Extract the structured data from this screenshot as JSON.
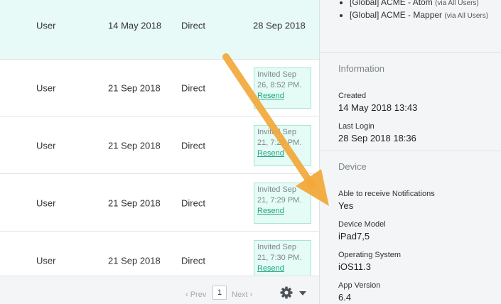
{
  "table": {
    "rows": [
      {
        "role": "User",
        "created": "14 May 2018",
        "type": "Direct",
        "last_login": "28 Sep 2018"
      },
      {
        "role": "User",
        "created": "21 Sep 2018",
        "type": "Direct",
        "invite_text": "Invited Sep 26, 8:52 PM.",
        "invite_link": "Resend"
      },
      {
        "role": "User",
        "created": "21 Sep 2018",
        "type": "Direct",
        "invite_text": "Invited Sep 21, 7:29 PM.",
        "invite_link": "Resend"
      },
      {
        "role": "User",
        "created": "21 Sep 2018",
        "type": "Direct",
        "invite_text": "Invited Sep 21, 7:29 PM.",
        "invite_link": "Resend"
      },
      {
        "role": "User",
        "created": "21 Sep 2018",
        "type": "Direct",
        "invite_text": "Invited Sep 21, 7:30 PM.",
        "invite_link": "Resend"
      }
    ]
  },
  "pagination": {
    "prev": "‹ Prev",
    "page": "1",
    "next": "Next ›"
  },
  "icons": {
    "settings": "gear-icon",
    "dropdown": "caret-down-icon"
  },
  "panel": {
    "groups": [
      {
        "name": "[Global] ACME - Atom",
        "via": "(via All Users)"
      },
      {
        "name": "[Global] ACME - Mapper",
        "via": "(via All Users)"
      }
    ],
    "information": {
      "title": "Information",
      "created_label": "Created",
      "created_value": "14 May 2018 13:43",
      "last_login_label": "Last Login",
      "last_login_value": "28 Sep 2018 18:36"
    },
    "device": {
      "title": "Device",
      "notifications_label": "Able to receive Notifications",
      "notifications_value": "Yes",
      "model_label": "Device Model",
      "model_value": "iPad7,5",
      "os_label": "Operating System",
      "os_value": "iOS11.3",
      "app_version_label": "App Version",
      "app_version_value": "6.4"
    }
  },
  "colors": {
    "highlight_row": "#e7faf7",
    "invite_bg": "#e5fbf5",
    "link": "#1ea57f",
    "arrow": "#f2a93b"
  }
}
